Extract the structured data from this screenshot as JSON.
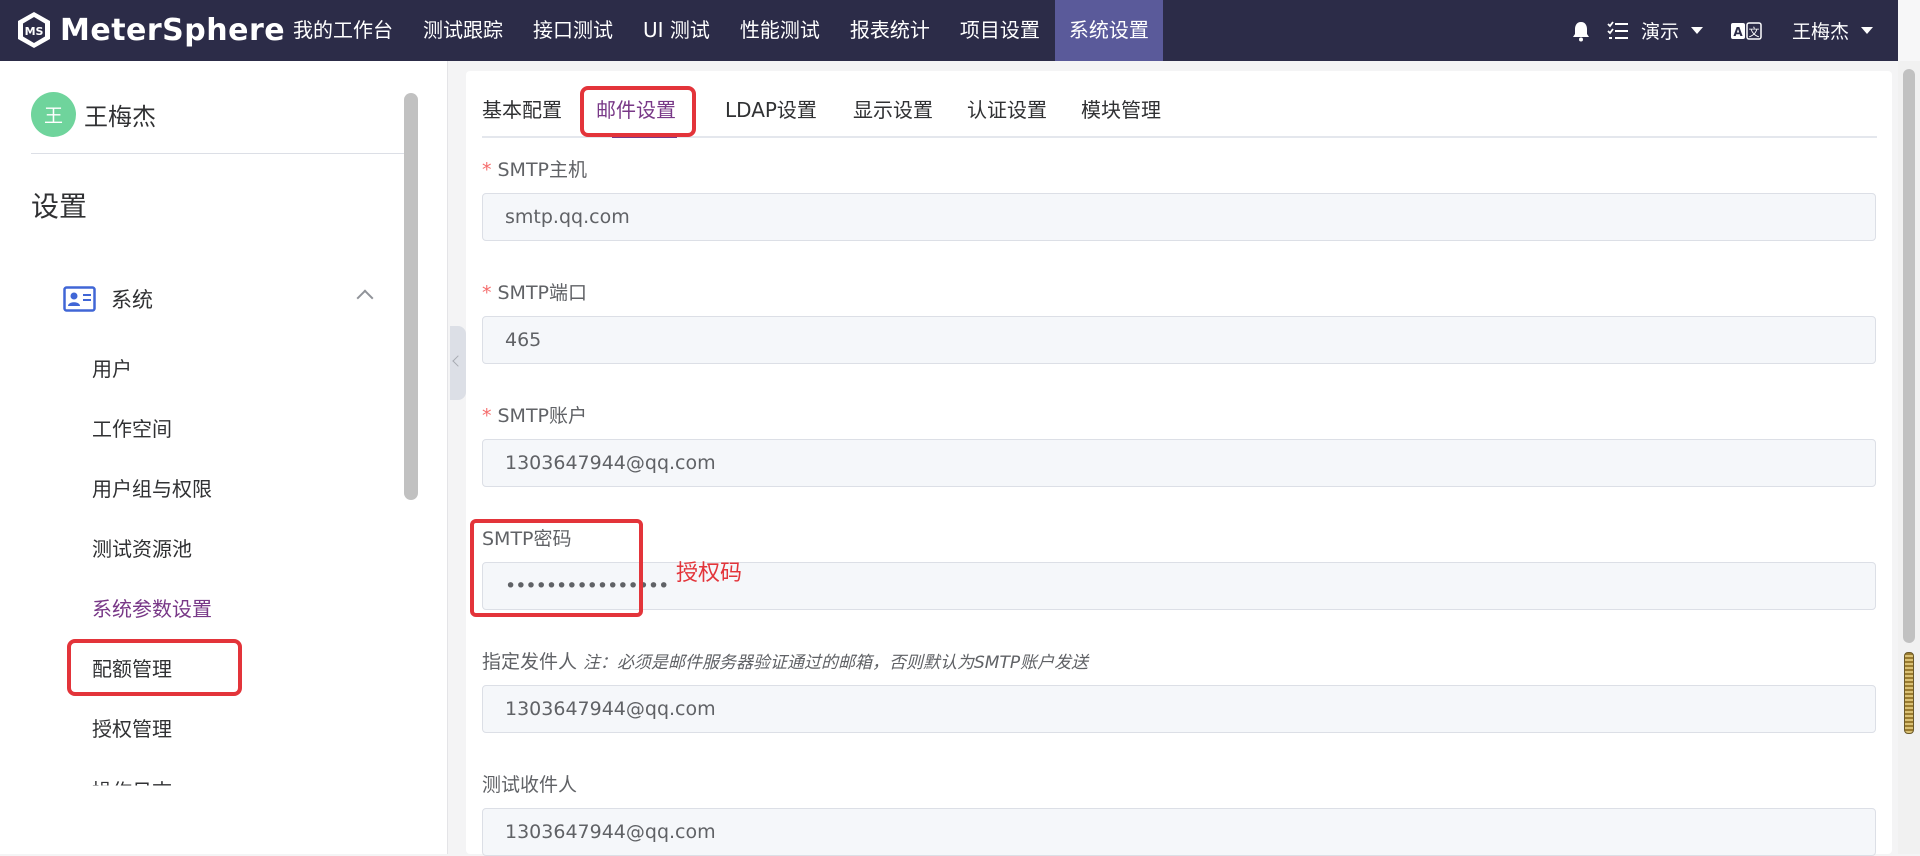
{
  "header": {
    "brand": "MeterSphere",
    "nav": [
      "我的工作台",
      "测试跟踪",
      "接口测试",
      "UI 测试",
      "性能测试",
      "报表统计",
      "项目设置",
      "系统设置"
    ],
    "active_nav": "系统设置",
    "workspace": "演示",
    "user": "王梅杰"
  },
  "sidebar": {
    "avatar_letter": "王",
    "user_name": "王梅杰",
    "title": "设置",
    "group": "系统",
    "items": [
      "用户",
      "工作空间",
      "用户组与权限",
      "测试资源池",
      "系统参数设置",
      "配额管理",
      "授权管理",
      "操作日志"
    ],
    "active_item": "系统参数设置"
  },
  "tabs": [
    "基本配置",
    "邮件设置",
    "LDAP设置",
    "显示设置",
    "认证设置",
    "模块管理"
  ],
  "active_tab": "邮件设置",
  "form": {
    "required_mark": "*",
    "smtp_host_label": "SMTP主机",
    "smtp_host_value": "smtp.qq.com",
    "smtp_port_label": "SMTP端口",
    "smtp_port_value": "465",
    "smtp_account_label": "SMTP账户",
    "smtp_account_value": "1303647944@qq.com",
    "smtp_password_label": "SMTP密码",
    "smtp_password_value": "••••••••••••••••",
    "password_annotation": "授权码",
    "sender_label": "指定发件人",
    "sender_note": "注：必须是邮件服务器验证通过的邮箱，否则默认为SMTP账户发送",
    "sender_value": "1303647944@qq.com",
    "recipient_label": "测试收件人",
    "recipient_value": "1303647944@qq.com"
  },
  "colors": {
    "header_bg": "#2c2c48",
    "accent": "#783887",
    "highlight": "#e3343a"
  }
}
